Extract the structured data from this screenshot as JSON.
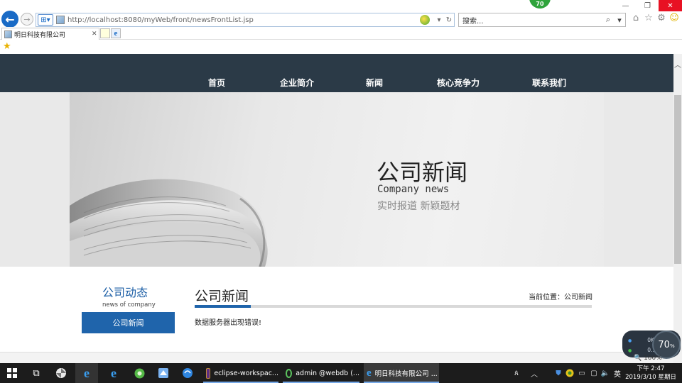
{
  "browser": {
    "url": "http://localhost:8080/myWeb/front/newsFrontList.jsp",
    "search_placeholder": "搜索...",
    "tab_title": "明日科技有限公司",
    "badge": "70",
    "zoom": "100%"
  },
  "site": {
    "nav": [
      "首页",
      "企业简介",
      "新闻",
      "核心竞争力",
      "联系我们"
    ],
    "banner": {
      "title": "公司新闻",
      "subtitle_en": "Company news",
      "tagline": "实时报道  新颖题材"
    },
    "sidebar": {
      "title": "公司动态",
      "subtitle": "news of company",
      "button": "公司新闻"
    },
    "main": {
      "title": "公司新闻",
      "location": "当前位置：公司新闻",
      "message": "数据服务器出现错误!"
    }
  },
  "network": {
    "upload": "0K/s",
    "download": "0.1K/s",
    "gauge": "70",
    "gauge_unit": "%"
  },
  "taskbar": {
    "apps": [
      {
        "label": "eclipse-workspac..."
      },
      {
        "label": "admin @webdb (..."
      },
      {
        "label": "明日科技有限公司 ..."
      }
    ],
    "ime": "英",
    "time": "下午 2:47",
    "date": "2019/3/10 星期日"
  }
}
